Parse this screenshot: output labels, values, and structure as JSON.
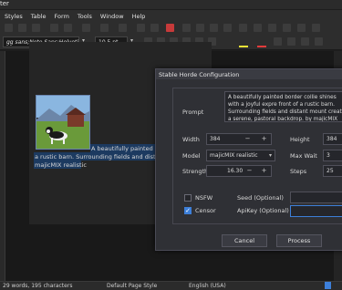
{
  "window": {
    "title_fragment": "ter"
  },
  "menu": [
    "Styles",
    "Table",
    "Form",
    "Tools",
    "Window",
    "Help"
  ],
  "format": {
    "font_name": "gg sans;Noto Sans;Helveti",
    "font_size": "10.5 pt"
  },
  "document": {
    "line1": "A beautifully painted bord",
    "line2": "a rustic barn. Surrounding fields and distant mo",
    "line3": "majicMIX realistic"
  },
  "dialog": {
    "title": "Stable Horde Configuration",
    "prompt_label": "Prompt",
    "prompt_text": "A beautifully painted border collie shines with a joyful expre front of a rustic barn. Surrounding fields and distant mount create a serene, pastoral backdrop.  by  majicMIX realistic",
    "width_label": "Width",
    "width_value": "384",
    "height_label": "Height",
    "height_value": "384",
    "model_label": "Model",
    "model_value": "majicMIX realistic",
    "maxwait_label": "Max Wait",
    "maxwait_value": "3",
    "strength_label": "Strength",
    "strength_value": "16.30",
    "steps_label": "Steps",
    "steps_value": "25",
    "nsfw_label": "NSFW",
    "censor_label": "Censor",
    "seed_label": "Seed (Optional)",
    "apikey_label": "ApiKey (Optional)",
    "cancel_label": "Cancel",
    "process_label": "Process",
    "minus": "−",
    "plus": "+",
    "check": "✓",
    "arrow": "▾"
  },
  "status": {
    "words": "29 words, 195 characters",
    "page_style": "Default Page Style",
    "language": "English (USA)"
  }
}
